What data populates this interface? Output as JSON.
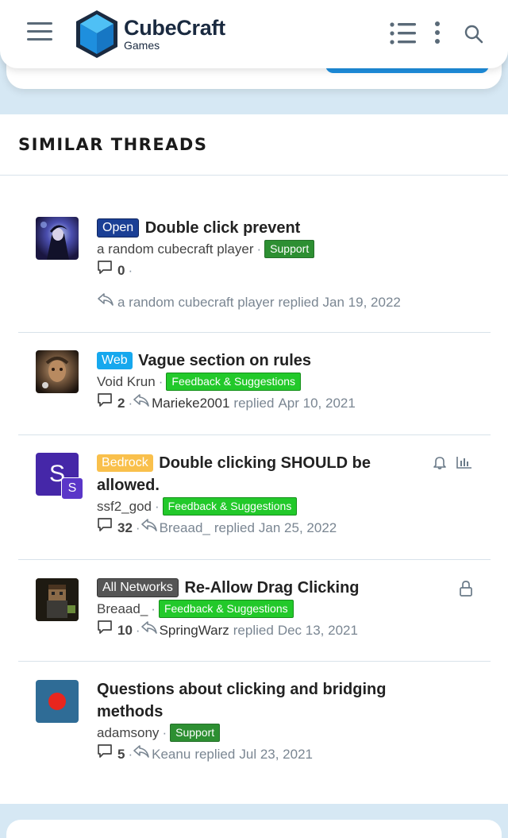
{
  "header": {
    "logo_name": "CubeCraft",
    "logo_sub": "Games",
    "brand_color": "#1e8fde"
  },
  "section_title": "SIMILAR THREADS",
  "threads": [
    {
      "prefix": "Open",
      "prefix_color": "#1b3f95",
      "title": "Double click prevent",
      "author": "a random cubecraft player",
      "tag": "Support",
      "replies": "0",
      "last_user": "a random cubecraft player",
      "last_text": "replied",
      "last_date": "Jan 19, 2022"
    },
    {
      "prefix": "Web",
      "prefix_color": "#16a8ee",
      "title": "Vague section on rules",
      "author": "Void Krun",
      "tag": "Feedback & Suggestions",
      "replies": "2",
      "last_user": "Marieke2001",
      "last_text": "replied",
      "last_date": "Apr 10, 2021"
    },
    {
      "prefix": "Bedrock",
      "prefix_color": "#f9c04c",
      "title": "Double clicking SHOULD be allowed.",
      "author": "ssf2_god",
      "avatar_letter": "S",
      "tag": "Feedback & Suggestions",
      "replies": "32",
      "last_user": "Breaad_",
      "last_text": "replied",
      "last_date": "Jan 25, 2022"
    },
    {
      "prefix": "All Networks",
      "prefix_color": "#555555",
      "title": "Re-Allow Drag Clicking",
      "author": "Breaad_",
      "tag": "Feedback & Suggestions",
      "replies": "10",
      "last_user": "SpringWarz",
      "last_text": "replied",
      "last_date": "Dec 13, 2021"
    },
    {
      "title": "Questions about clicking and bridging methods",
      "author": "adamsony",
      "tag": "Support",
      "replies": "5",
      "last_user": "Keanu",
      "last_text": "replied",
      "last_date": "Jul 23, 2021"
    }
  ]
}
